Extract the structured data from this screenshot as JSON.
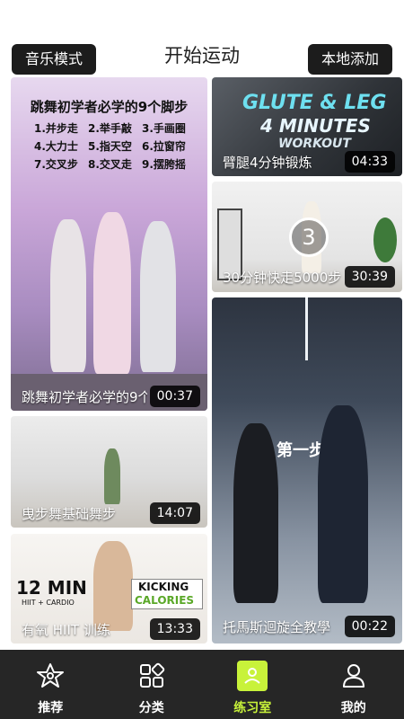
{
  "header": {
    "left_button": "音乐模式",
    "title": "开始运动",
    "right_button": "本地添加"
  },
  "cards": [
    {
      "caption": "跳舞初学者必学的9个脚步",
      "duration": "00:37",
      "banner_title": "跳舞初学者必学的9个脚步",
      "steps": [
        "1.并步走",
        "2.举手敲",
        "3.手画圈",
        "4.大力士",
        "5.指天空",
        "6.拉窗帘",
        "7.交叉步",
        "8.交叉走",
        "9.摆胯摇"
      ]
    },
    {
      "caption": "臂腿4分钟锻炼",
      "duration": "04:33",
      "overlay_line1": "GLUTE & LEG",
      "overlay_line2": "4 MINUTES",
      "overlay_line3": "WORKOUT"
    },
    {
      "caption": "30分钟快走5000步",
      "duration": "30:39",
      "overlay_number": "3"
    },
    {
      "caption": "曳步舞基础舞步",
      "duration": "14:07"
    },
    {
      "caption": "托馬斯迴旋全教學",
      "duration": "00:22",
      "overlay_text": "第一步"
    },
    {
      "caption": "有氧 HIIT 训练",
      "duration": "13:33",
      "overlay_left_big": "12 MIN",
      "overlay_left_small": "HIIT + CARDIO",
      "overlay_right_line1": "KICKING",
      "overlay_right_line2": "CALORIES"
    }
  ],
  "nav": {
    "items": [
      {
        "label": "推荐",
        "icon": "star-icon"
      },
      {
        "label": "分类",
        "icon": "category-grid-icon"
      },
      {
        "label": "练习室",
        "icon": "practice-room-icon"
      },
      {
        "label": "我的",
        "icon": "profile-icon"
      }
    ],
    "active_index": 2,
    "active_color": "#c8f23a"
  }
}
